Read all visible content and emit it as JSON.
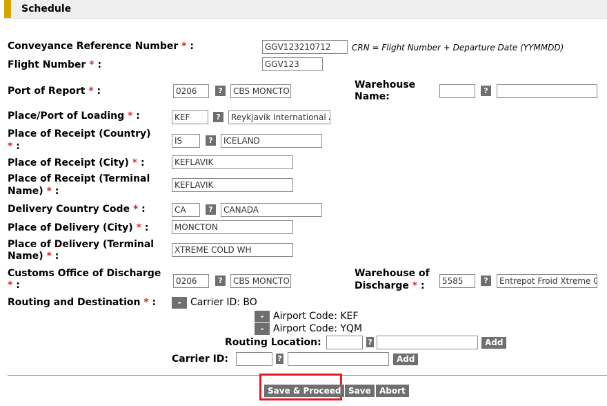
{
  "section": {
    "title": "Schedule"
  },
  "required_marker": "*",
  "help_symbol": "?",
  "remove_symbol": "-",
  "fields": {
    "crn": {
      "label": "Conveyance Reference Number",
      "value": "GGV123210712",
      "note": "CRN = Flight Number + Departure Date (YYMMDD)"
    },
    "flight_number": {
      "label": "Flight Number",
      "value": "GGV123"
    },
    "port_of_report": {
      "label": "Port of Report",
      "code": "0206",
      "name": "CBS MONCTO"
    },
    "warehouse_name": {
      "label_line1": "Warehouse",
      "label_line2": "Name:",
      "code": "",
      "name": ""
    },
    "port_of_loading": {
      "label": "Place/Port of Loading",
      "code": "KEF",
      "name": "Reykjavik International A"
    },
    "receipt_country": {
      "label_line1": "Place of Receipt (Country)",
      "code": "IS",
      "name": "ICELAND"
    },
    "receipt_city": {
      "label": "Place of Receipt (City)",
      "value": "KEFLAVIK"
    },
    "receipt_terminal": {
      "label_line1": "Place of Receipt (Terminal",
      "label_line2": "Name)",
      "value": "KEFLAVIK"
    },
    "delivery_country": {
      "label": "Delivery Country Code",
      "code": "CA",
      "name": "CANADA"
    },
    "delivery_city": {
      "label": "Place of Delivery (City)",
      "value": "MONCTON"
    },
    "delivery_terminal": {
      "label_line1": "Place of Delivery (Terminal",
      "label_line2": "Name)",
      "value": "XTREME COLD WH"
    },
    "customs_office": {
      "label_line1": "Customs Office of Discharge",
      "code": "0206",
      "name": "CBS MONCTO"
    },
    "warehouse_discharge": {
      "label_line1": "Warehouse of",
      "label_line2": "Discharge",
      "code": "5585",
      "name": "Entrepot Froid Xtreme C"
    }
  },
  "routing": {
    "label": "Routing and Destination",
    "carrier_text": "Carrier ID:  BO",
    "airports": [
      {
        "text": "Airport Code:  KEF"
      },
      {
        "text": "Airport Code:  YQM"
      }
    ],
    "routing_location_label": "Routing Location:",
    "routing_location_code": "",
    "routing_location_name": "",
    "carrier_id_label": "Carrier ID:",
    "carrier_id_code": "",
    "carrier_id_name": "",
    "add_label": "Add"
  },
  "actions": {
    "save_proceed": "Save & Proceed",
    "save": "Save",
    "abort": "Abort"
  },
  "colors": {
    "accent": "#d9a300",
    "required": "#d9262e",
    "button_bg": "#6f6f6f",
    "highlight": "#e11b22"
  }
}
